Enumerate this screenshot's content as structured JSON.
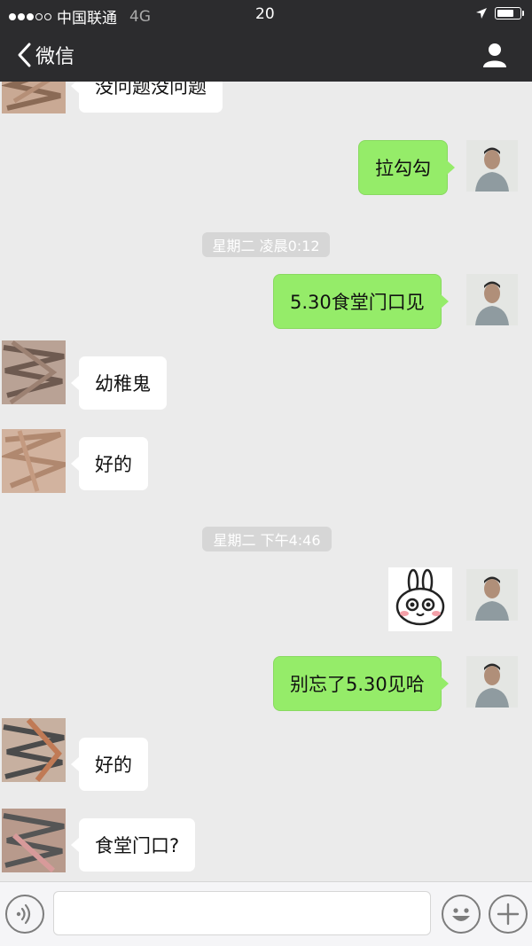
{
  "status_bar": {
    "carrier": "中国联通",
    "network": "4G",
    "time": "20",
    "signal_dots_filled": 3,
    "signal_dots_total": 5,
    "battery_level_fraction": 0.75
  },
  "nav": {
    "back_label": "微信",
    "back_icon": "chevron-left-icon",
    "profile_icon": "person-icon"
  },
  "messages": [
    {
      "side": "left",
      "type": "text",
      "text": "没问题没问题"
    },
    {
      "side": "right",
      "type": "text",
      "text": "拉勾勾"
    },
    {
      "type": "timestamp",
      "text": "星期二 凌晨0:12"
    },
    {
      "side": "right",
      "type": "text",
      "text": "5.30食堂门口见"
    },
    {
      "side": "left",
      "type": "text",
      "text": "幼稚鬼"
    },
    {
      "side": "left",
      "type": "text",
      "text": "好的"
    },
    {
      "type": "timestamp",
      "text": "星期二 下午4:46"
    },
    {
      "side": "right",
      "type": "sticker",
      "icon": "bunny-sticker-icon"
    },
    {
      "side": "right",
      "type": "text",
      "text": "别忘了5.30见哈"
    },
    {
      "side": "left",
      "type": "text",
      "text": "好的"
    },
    {
      "side": "left",
      "type": "text",
      "text": "食堂门口?"
    }
  ],
  "input_bar": {
    "voice_icon": "voice-icon",
    "emoji_icon": "emoji-icon",
    "plus_icon": "plus-icon",
    "text_value": "",
    "placeholder": ""
  },
  "colors": {
    "nav_background": "#2c2c2e",
    "chat_background": "#ebebeb",
    "bubble_self": "#95ec69",
    "bubble_other": "#ffffff",
    "timestamp_background": "#d6d6d6"
  }
}
